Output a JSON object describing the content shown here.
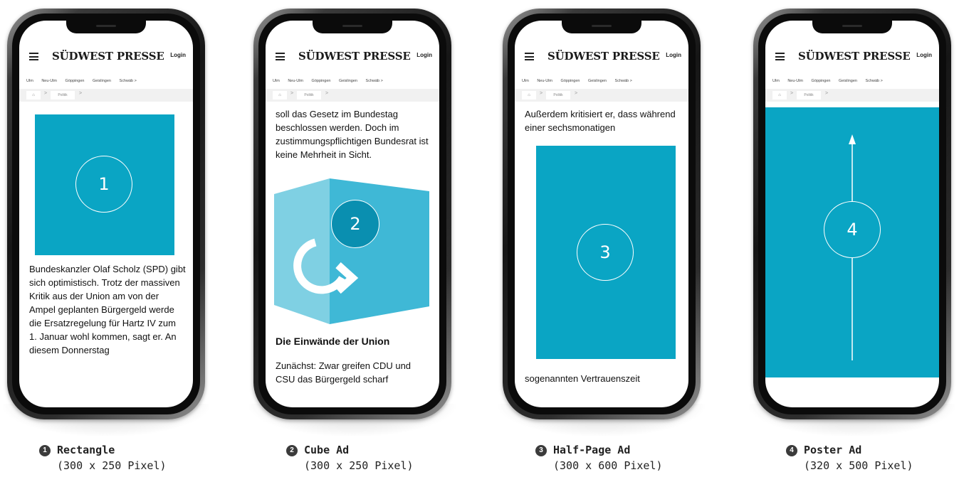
{
  "site": {
    "brand": "SÜDWEST PRESSE",
    "login": "Login",
    "nav": [
      "Ulm",
      "Neu-Ulm",
      "Göppingen",
      "Geislingen",
      "Schwäb >"
    ],
    "breadcrumb_home": "⌂",
    "breadcrumb_item": "Politik",
    "breadcrumb_sep": ">"
  },
  "ad_color": "#0aa5c4",
  "phones": [
    {
      "number": "1",
      "text_after": "Bundeskanzler Olaf Scholz (SPD) gibt sich optimistisch. Trotz der massiven Kritik aus der Union am von der Ampel geplanten Bürgergeld werde die Ersatzregelung für Hartz IV zum 1. Januar wohl kommen, sagt er. An diesem Donnerstag",
      "caption_title": "Rectangle",
      "caption_size": "(300 x 250 Pixel)",
      "badge": "1"
    },
    {
      "number": "2",
      "text_before": "soll das Gesetz im Bundestag beschlossen werden. Doch im zustimmungspflichtigen Bundesrat ist keine Mehrheit in Sicht.",
      "heading_after": "Die Einwände der Union",
      "text_after": "Zunächst: Zwar greifen CDU und CSU das Bürgergeld scharf",
      "caption_title": "Cube Ad",
      "caption_size": "(300 x 250 Pixel)",
      "badge": "2"
    },
    {
      "number": "3",
      "text_before": "Außerdem kritisiert er, dass während einer sechsmonatigen",
      "text_after": "sogenannten Vertrauenszeit",
      "caption_title": "Half-Page Ad",
      "caption_size": "(300 x 600 Pixel)",
      "badge": "3"
    },
    {
      "number": "4",
      "caption_title": "Poster Ad",
      "caption_size": "(320 x 500 Pixel)",
      "badge": "4"
    }
  ]
}
